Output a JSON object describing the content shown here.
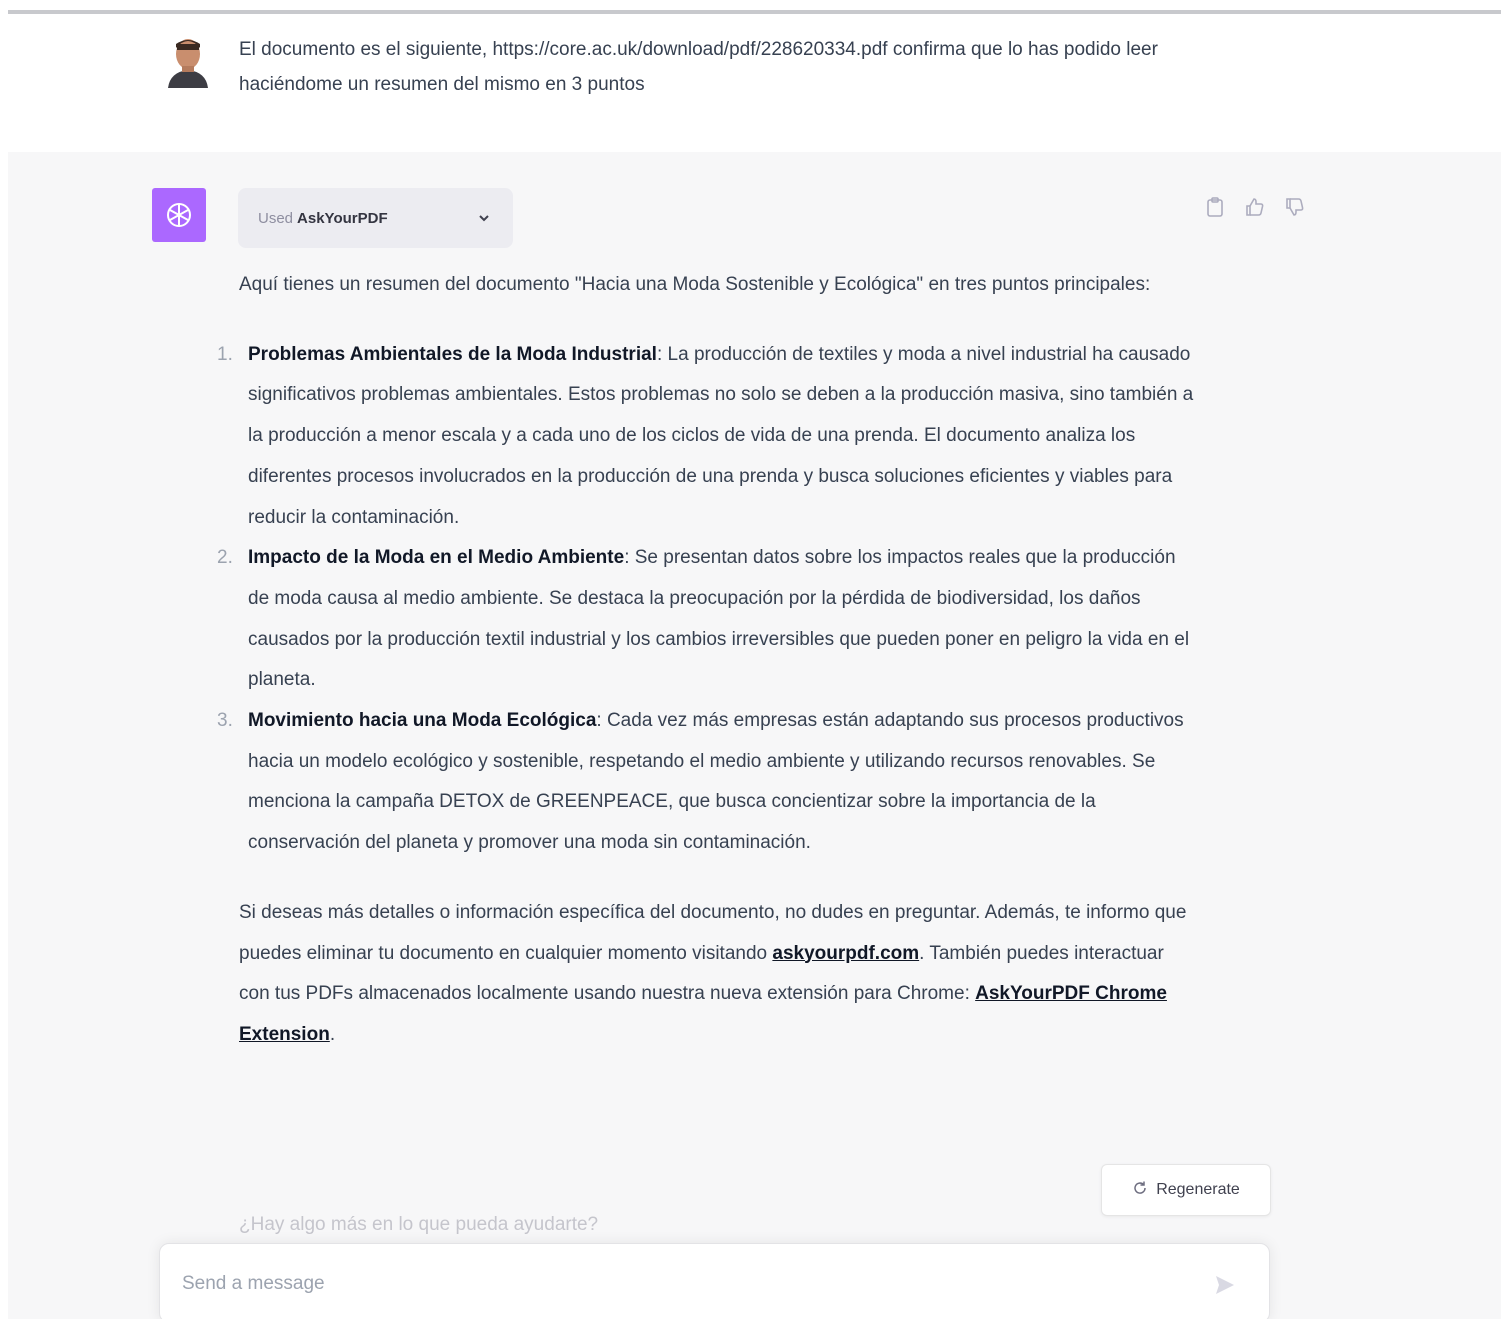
{
  "user_message": {
    "text": "El documento es el siguiente, https://core.ac.uk/download/pdf/228620334.pdf confirma que lo has podido leer haciéndome un resumen del mismo en 3 puntos"
  },
  "assistant": {
    "plugin_used_label": "Used",
    "plugin_name": "AskYourPDF",
    "intro": "Aquí tienes un resumen del documento \"Hacia una Moda Sostenible y Ecológica\" en tres puntos principales:",
    "points": [
      {
        "number": "1.",
        "title": "Problemas Ambientales de la Moda Industrial",
        "body": ": La producción de textiles y moda a nivel industrial ha causado significativos problemas ambientales. Estos problemas no solo se deben a la producción masiva, sino también a la producción a menor escala y a cada uno de los ciclos de vida de una prenda. El documento analiza los diferentes procesos involucrados en la producción de una prenda y busca soluciones eficientes y viables para reducir la contaminación."
      },
      {
        "number": "2.",
        "title": "Impacto de la Moda en el Medio Ambiente",
        "body": ": Se presentan datos sobre los impactos reales que la producción de moda causa al medio ambiente. Se destaca la preocupación por la pérdida de biodiversidad, los daños causados por la producción textil industrial y los cambios irreversibles que pueden poner en peligro la vida en el planeta."
      },
      {
        "number": "3.",
        "title": "Movimiento hacia una Moda Ecológica",
        "body": ": Cada vez más empresas están adaptando sus procesos productivos hacia un modelo ecológico y sostenible, respetando el medio ambiente y utilizando recursos renovables. Se menciona la campaña DETOX de GREENPEACE, que busca concientizar sobre la importancia de la conservación del planeta y promover una moda sin contaminación."
      }
    ],
    "closing_part1": "Si deseas más detalles o información específica del documento, no dudes en preguntar. Además, te informo que puedes eliminar tu documento en cualquier momento visitando ",
    "closing_link1": "askyourpdf.com",
    "closing_part2": ". También puedes interactuar con tus PDFs almacenados localmente usando nuestra nueva extensión para Chrome: ",
    "closing_link2": "AskYourPDF Chrome Extension",
    "closing_part3": ".",
    "followup": "¿Hay algo más en lo que pueda ayudarte?"
  },
  "regenerate_label": "Regenerate",
  "composer": {
    "placeholder": "Send a message"
  },
  "icons": {
    "user_avatar": "user-photo",
    "assistant_avatar": "openai-logo-icon",
    "copy": "clipboard-icon",
    "like": "thumbs-up-icon",
    "dislike": "thumbs-down-icon",
    "regenerate": "refresh-icon",
    "send": "send-arrow-icon",
    "chevron": "chevron-down-icon"
  },
  "colors": {
    "assistant_avatar_bg": "#ab68ff",
    "assistant_row_bg": "#f7f7f8",
    "text": "#374151"
  }
}
